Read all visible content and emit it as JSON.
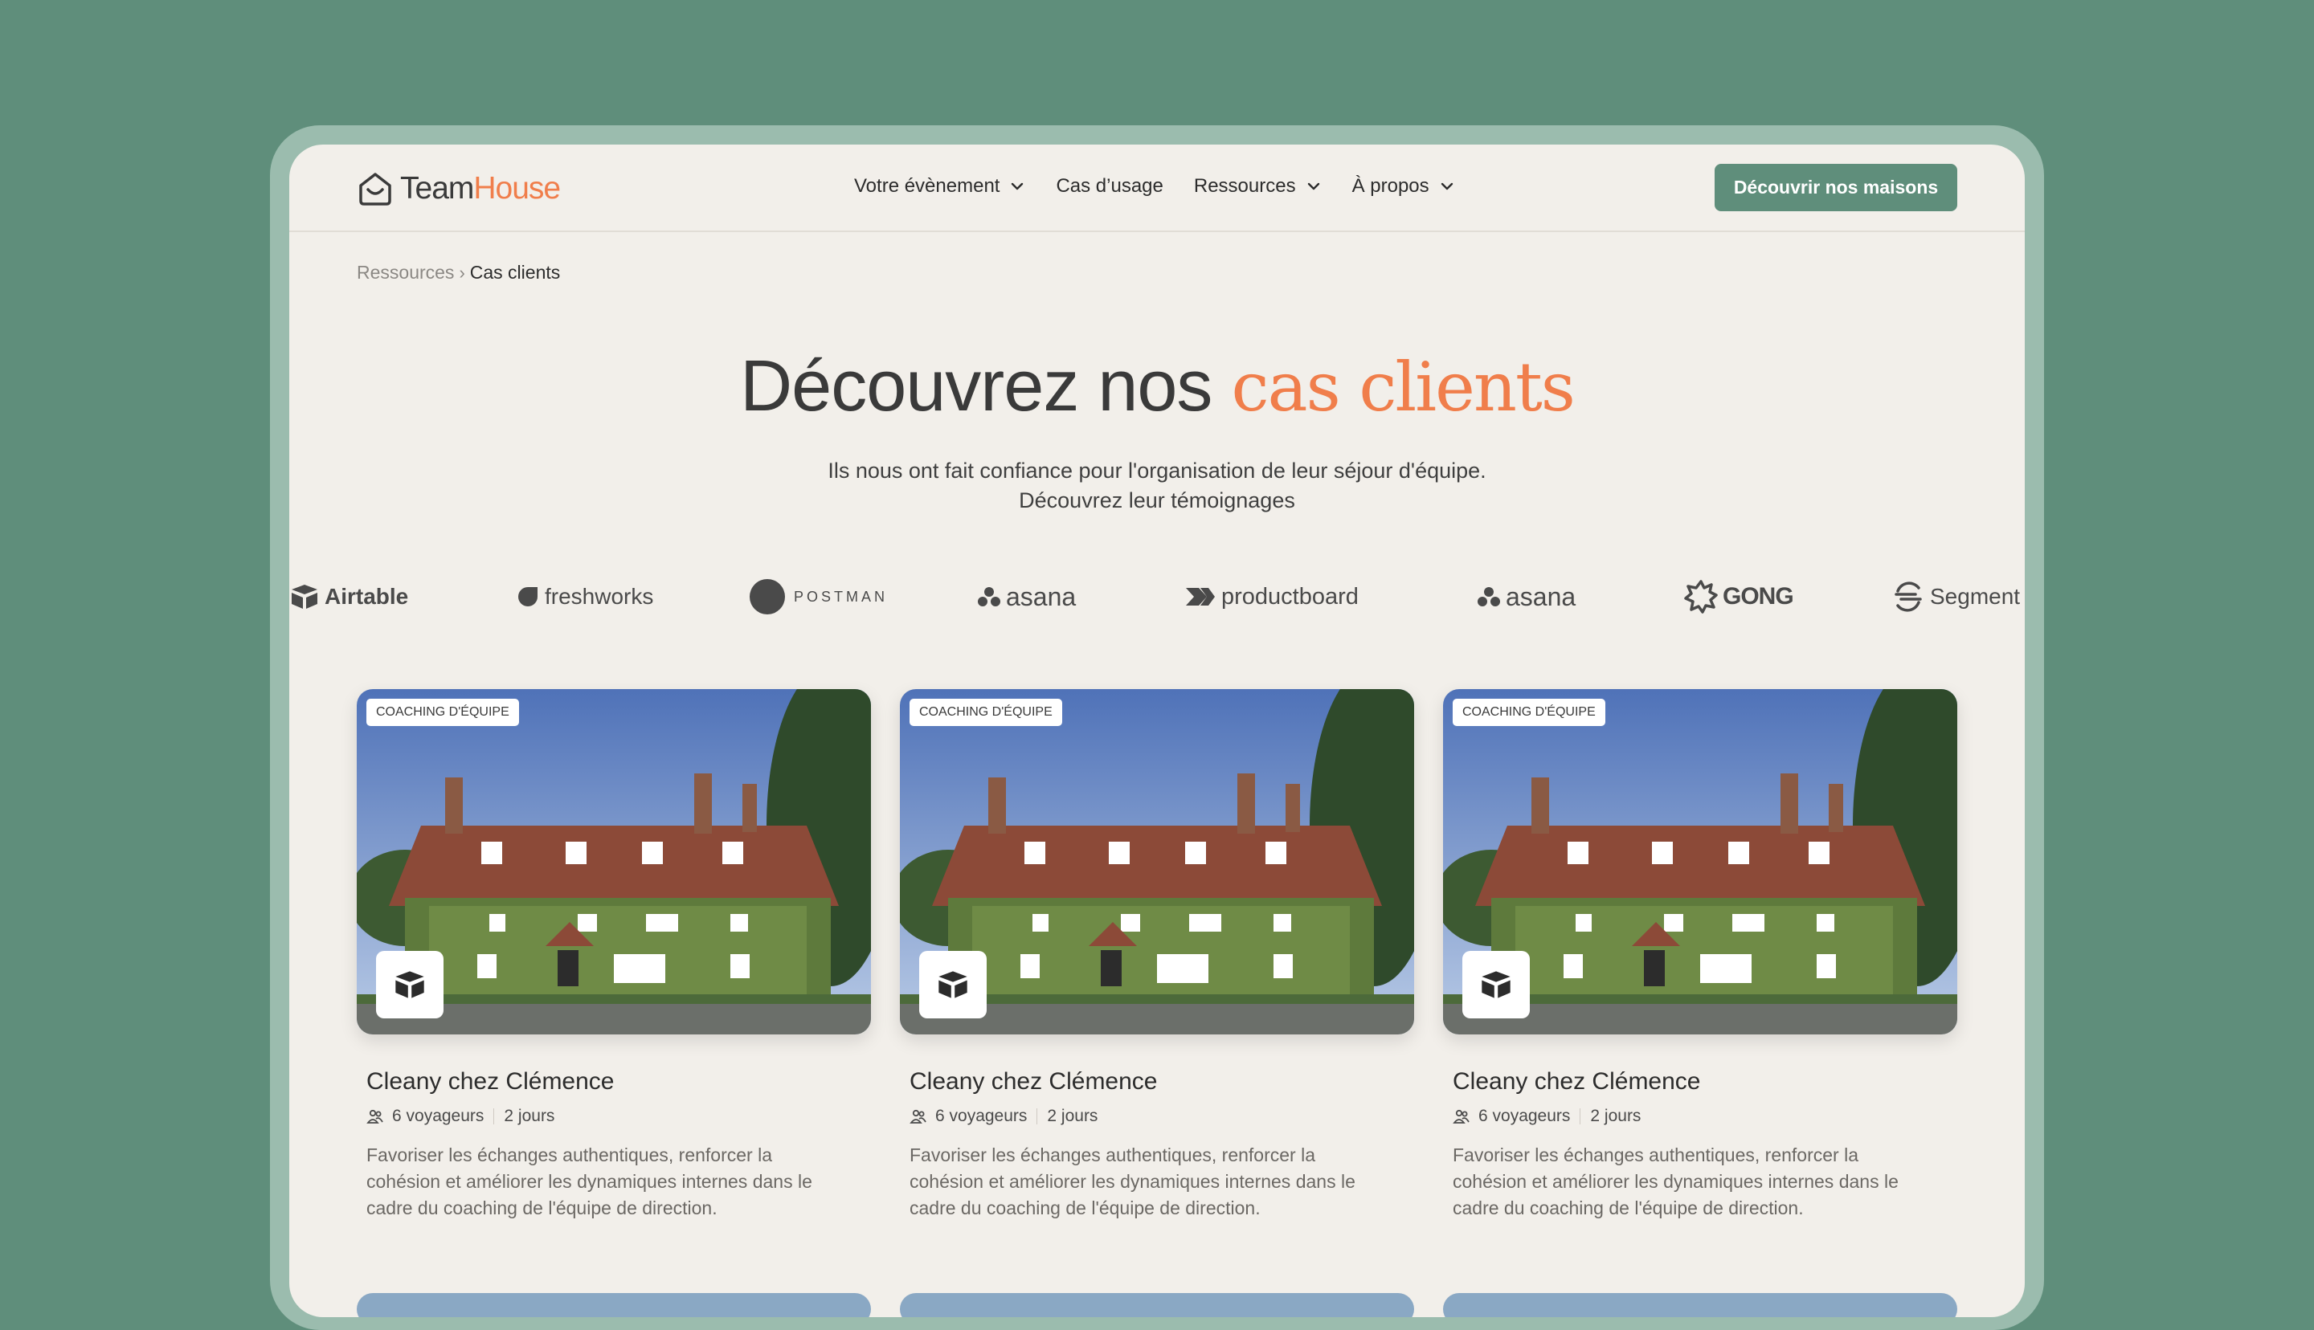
{
  "header": {
    "logo_team": "Team",
    "logo_house": "House",
    "nav": [
      {
        "label": "Votre évènement",
        "has_dropdown": true
      },
      {
        "label": "Cas d’usage",
        "has_dropdown": false
      },
      {
        "label": "Ressources",
        "has_dropdown": true
      },
      {
        "label": "À propos",
        "has_dropdown": true
      }
    ],
    "cta_label": "Découvrir nos maisons"
  },
  "breadcrumb": {
    "parent": "Ressources",
    "separator": "›",
    "current": "Cas clients"
  },
  "hero": {
    "title_plain": "Découvrez nos",
    "title_accent": "cas clients",
    "subtitle_line1": "Ils nous ont fait confiance pour l'organisation de leur séjour d'équipe.",
    "subtitle_line2": "Découvrez leur témoignages"
  },
  "client_logos": [
    {
      "name": "Airtable",
      "icon": "airtable-icon"
    },
    {
      "name": "freshworks",
      "icon": "freshworks-icon"
    },
    {
      "name": "POSTMAN",
      "icon": "postman-icon"
    },
    {
      "name": "asana",
      "icon": "asana-icon"
    },
    {
      "name": "productboard",
      "icon": "productboard-icon"
    },
    {
      "name": "asana",
      "icon": "asana-icon"
    },
    {
      "name": "GONG",
      "icon": "gong-icon"
    },
    {
      "name": "Segment",
      "icon": "segment-icon"
    }
  ],
  "cards": [
    {
      "tag": "COACHING D'ÉQUIPE",
      "title": "Cleany chez Clémence",
      "travelers": "6 voyageurs",
      "duration": "2 jours",
      "description": "Favoriser les échanges authentiques, renforcer la cohésion et améliorer les dynamiques internes dans le cadre du coaching de l'équipe de direction."
    },
    {
      "tag": "COACHING D'ÉQUIPE",
      "title": "Cleany chez Clémence",
      "travelers": "6 voyageurs",
      "duration": "2 jours",
      "description": "Favoriser les échanges authentiques, renforcer la cohésion et améliorer les dynamiques internes dans le cadre du coaching de l'équipe de direction."
    },
    {
      "tag": "COACHING D'ÉQUIPE",
      "title": "Cleany chez Clémence",
      "travelers": "6 voyageurs",
      "duration": "2 jours",
      "description": "Favoriser les échanges authentiques, renforcer la cohésion et améliorer les dynamiques internes dans le cadre du coaching de l'équipe de direction."
    }
  ],
  "colors": {
    "background": "#5f8e7b",
    "accent": "#f07e4b",
    "page": "#f2efea",
    "primary_button": "#5f8e7b"
  }
}
